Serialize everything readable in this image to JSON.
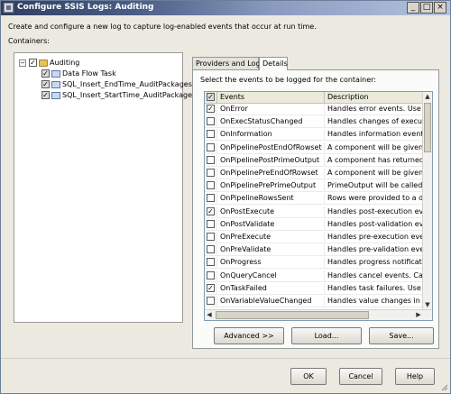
{
  "window": {
    "title": "Configure SSIS Logs: Auditing",
    "minimize_glyph": "_",
    "maximize_glyph": "□",
    "close_glyph": "×"
  },
  "intro_text": "Create and configure a new log to capture log-enabled events that occur at run time.",
  "containers_label": "Containers:",
  "tree": {
    "root": {
      "label": "Auditing",
      "checked": true,
      "expander": "−"
    },
    "children": [
      {
        "label": "Data Flow Task",
        "checked": true
      },
      {
        "label": "SQL_Insert_EndTime_AuditPackages",
        "checked": true
      },
      {
        "label": "SQL_Insert_StartTime_AuditPackages",
        "checked": true
      }
    ]
  },
  "tabs": [
    {
      "label": "Providers and Logs",
      "active": false
    },
    {
      "label": "Details",
      "active": true
    }
  ],
  "details": {
    "select_label": "Select the events to be logged for the container:",
    "columns": {
      "events": "Events",
      "description": "Description"
    },
    "rows": [
      {
        "event": "OnError",
        "description": "Handles error events. Use to d",
        "checked": true
      },
      {
        "event": "OnExecStatusChanged",
        "description": "Handles changes of execution",
        "checked": false
      },
      {
        "event": "OnInformation",
        "description": "Handles information events. Th",
        "checked": false
      },
      {
        "event": "OnPipelinePostEndOfRowset",
        "description": "A component will be given the",
        "checked": false
      },
      {
        "event": "OnPipelinePostPrimeOutput",
        "description": "A component has returned from",
        "checked": false
      },
      {
        "event": "OnPipelinePreEndOfRowset",
        "description": "A component will be given the",
        "checked": false
      },
      {
        "event": "OnPipelinePrePrimeOutput",
        "description": "PrimeOutput will be called on a",
        "checked": false
      },
      {
        "event": "OnPipelineRowsSent",
        "description": "Rows were provided to a data",
        "checked": false
      },
      {
        "event": "OnPostExecute",
        "description": "Handles post-execution events",
        "checked": true
      },
      {
        "event": "OnPostValidate",
        "description": "Handles post-validation events",
        "checked": false
      },
      {
        "event": "OnPreExecute",
        "description": "Handles pre-execution events.",
        "checked": false
      },
      {
        "event": "OnPreValidate",
        "description": "Handles pre-validation events.",
        "checked": false
      },
      {
        "event": "OnProgress",
        "description": "Handles progress notifications.",
        "checked": false
      },
      {
        "event": "OnQueryCancel",
        "description": "Handles cancel events. Called",
        "checked": false
      },
      {
        "event": "OnTaskFailed",
        "description": "Handles task failures. Use to d",
        "checked": true
      },
      {
        "event": "OnVariableValueChanged",
        "description": "Handles value changes in varia",
        "checked": false
      }
    ],
    "advanced_button": "Advanced >>",
    "load_button": "Load...",
    "save_button": "Save..."
  },
  "footer": {
    "ok": "OK",
    "cancel": "Cancel",
    "help": "Help"
  },
  "colors": {
    "title_bar": "#2f3f63",
    "dialog_bg": "#ece9e0",
    "grid_header": "#ebeadb"
  }
}
